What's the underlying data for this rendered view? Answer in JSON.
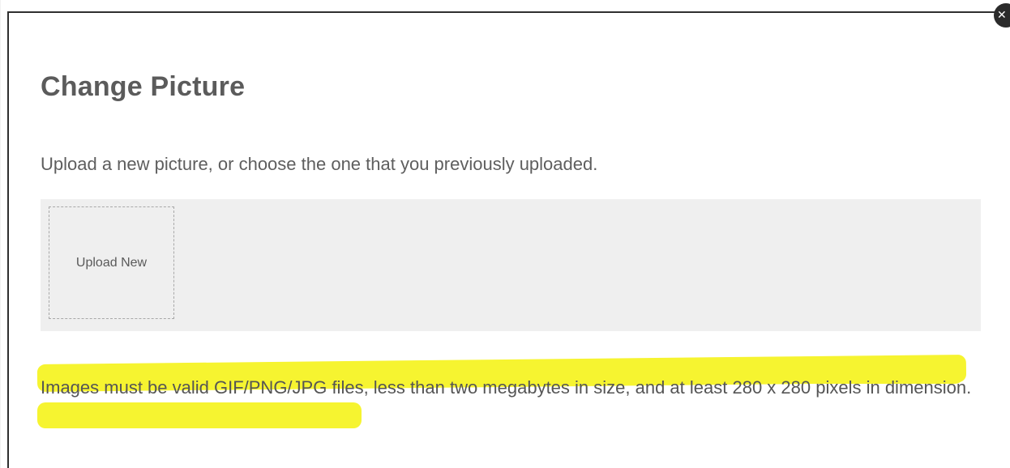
{
  "dialog": {
    "title": "Change Picture",
    "subtitle": "Upload a new picture, or choose the one that you previously uploaded.",
    "close_icon": "close-icon",
    "upload_tile_label": "Upload New",
    "note": "Images must be valid GIF/PNG/JPG files, less than two megabytes in size, and at least 280 x 280 pixels in dimension.",
    "highlight_color": "#f6f430"
  }
}
